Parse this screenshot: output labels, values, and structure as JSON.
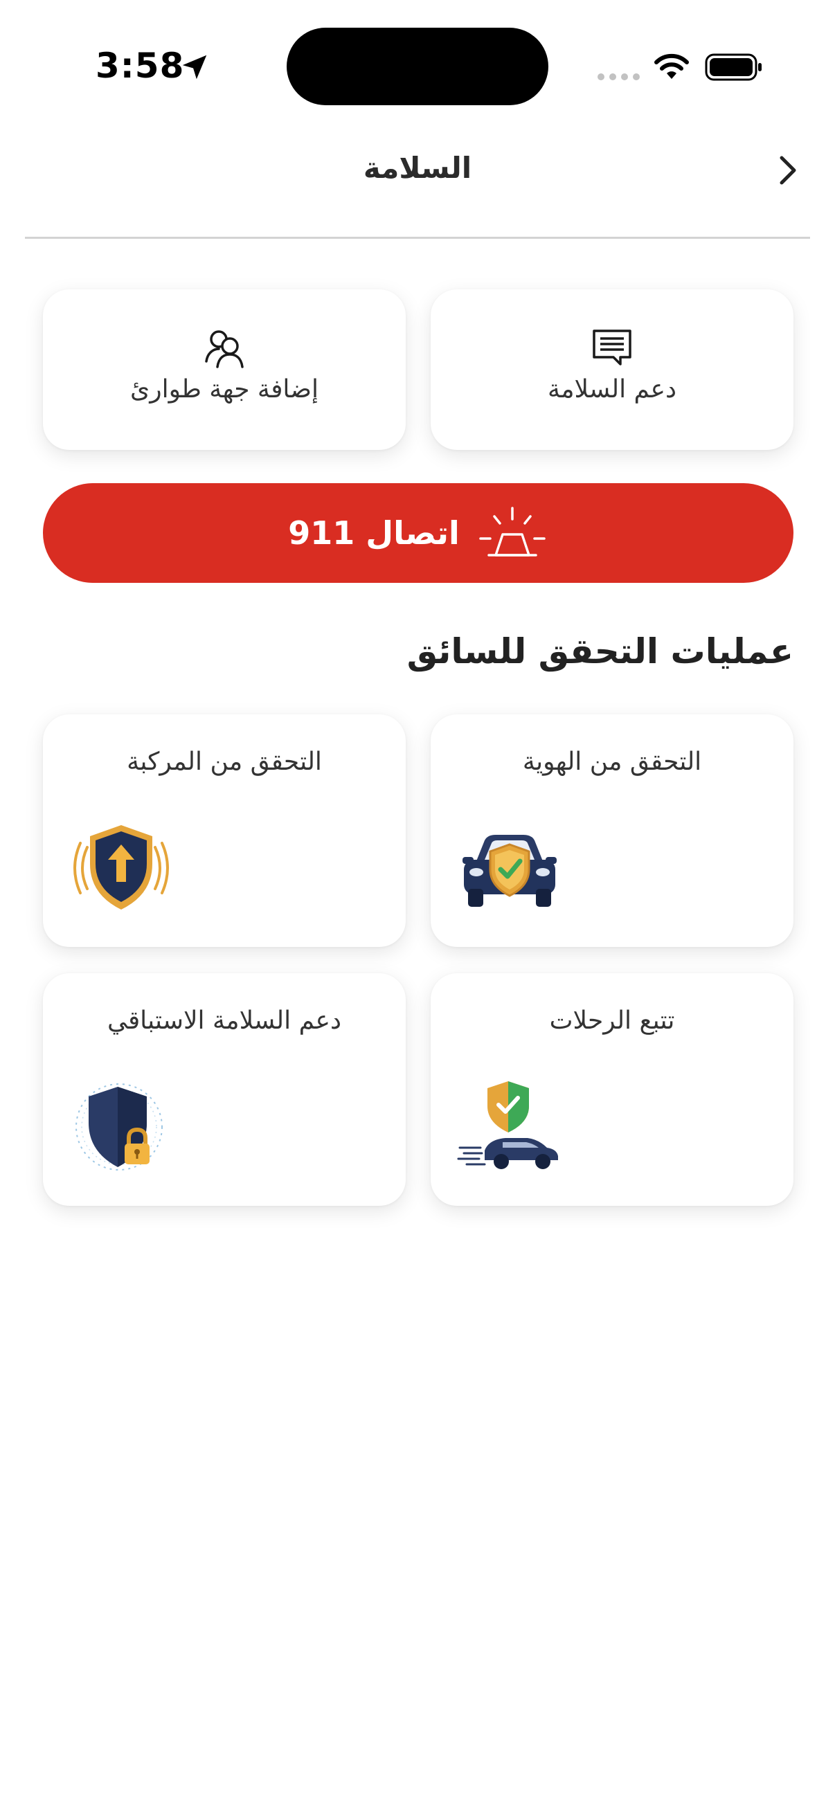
{
  "status_bar": {
    "time": "3:58",
    "icons": [
      "location-arrow-icon",
      "signal-dots-icon",
      "wifi-icon",
      "battery-icon"
    ]
  },
  "header": {
    "title": "السلامة",
    "back_icon": "chevron-right-icon"
  },
  "actions": {
    "safety_support": {
      "label": "دعم السلامة",
      "icon": "message-icon"
    },
    "emergency_contact": {
      "label": "إضافة جهة طوارئ",
      "icon": "add-contact-icon"
    }
  },
  "emergency_call": {
    "label": "اتصال 911",
    "icon": "siren-icon",
    "color": "#d92d22"
  },
  "verification": {
    "title": "عمليات التحقق للسائق",
    "items": [
      {
        "label": "التحقق من الهوية",
        "icon": "car-shield-icon"
      },
      {
        "label": "التحقق من المركبة",
        "icon": "shield-arrow-icon"
      },
      {
        "label": "تتبع الرحلات",
        "icon": "shield-car-motion-icon"
      },
      {
        "label": "دعم السلامة الاستباقي",
        "icon": "shield-lock-icon"
      }
    ]
  },
  "colors": {
    "accent_red": "#d92d22",
    "navy": "#1f2f55",
    "gold": "#e5a53a",
    "green": "#3ea956"
  }
}
